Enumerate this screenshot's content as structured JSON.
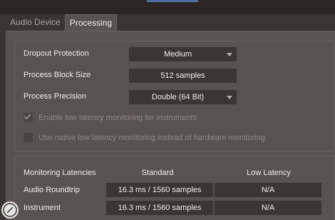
{
  "tabs": [
    {
      "label": "Audio Device",
      "active": false
    },
    {
      "label": "Processing",
      "active": true
    }
  ],
  "processing": {
    "dropout_protection": {
      "label": "Dropout Protection",
      "value": "Medium"
    },
    "process_block_size": {
      "label": "Process Block Size",
      "value": "512 samples"
    },
    "process_precision": {
      "label": "Process Precision",
      "value": "Double (64 Bit)"
    },
    "low_latency_instruments": {
      "label": "Enable low latency monitoring for instruments",
      "checked": true,
      "disabled": true
    },
    "native_low_latency": {
      "label": "Use native low latency monitoring instead of hardware monitoring",
      "checked": false,
      "disabled": true
    }
  },
  "latencies": {
    "header": {
      "label": "Monitoring Latencies",
      "standard": "Standard",
      "low": "Low Latency"
    },
    "rows": [
      {
        "label": "Audio Roundtrip",
        "standard": "16.3 ms / 1560 samples",
        "low": "N/A"
      },
      {
        "label": "Instrument",
        "standard": "16.3 ms / 1560 samples",
        "low": "N/A"
      }
    ]
  },
  "colors": {
    "accent": "#4a6fa0",
    "panel": "#5a5250",
    "field": "#3b3534"
  }
}
